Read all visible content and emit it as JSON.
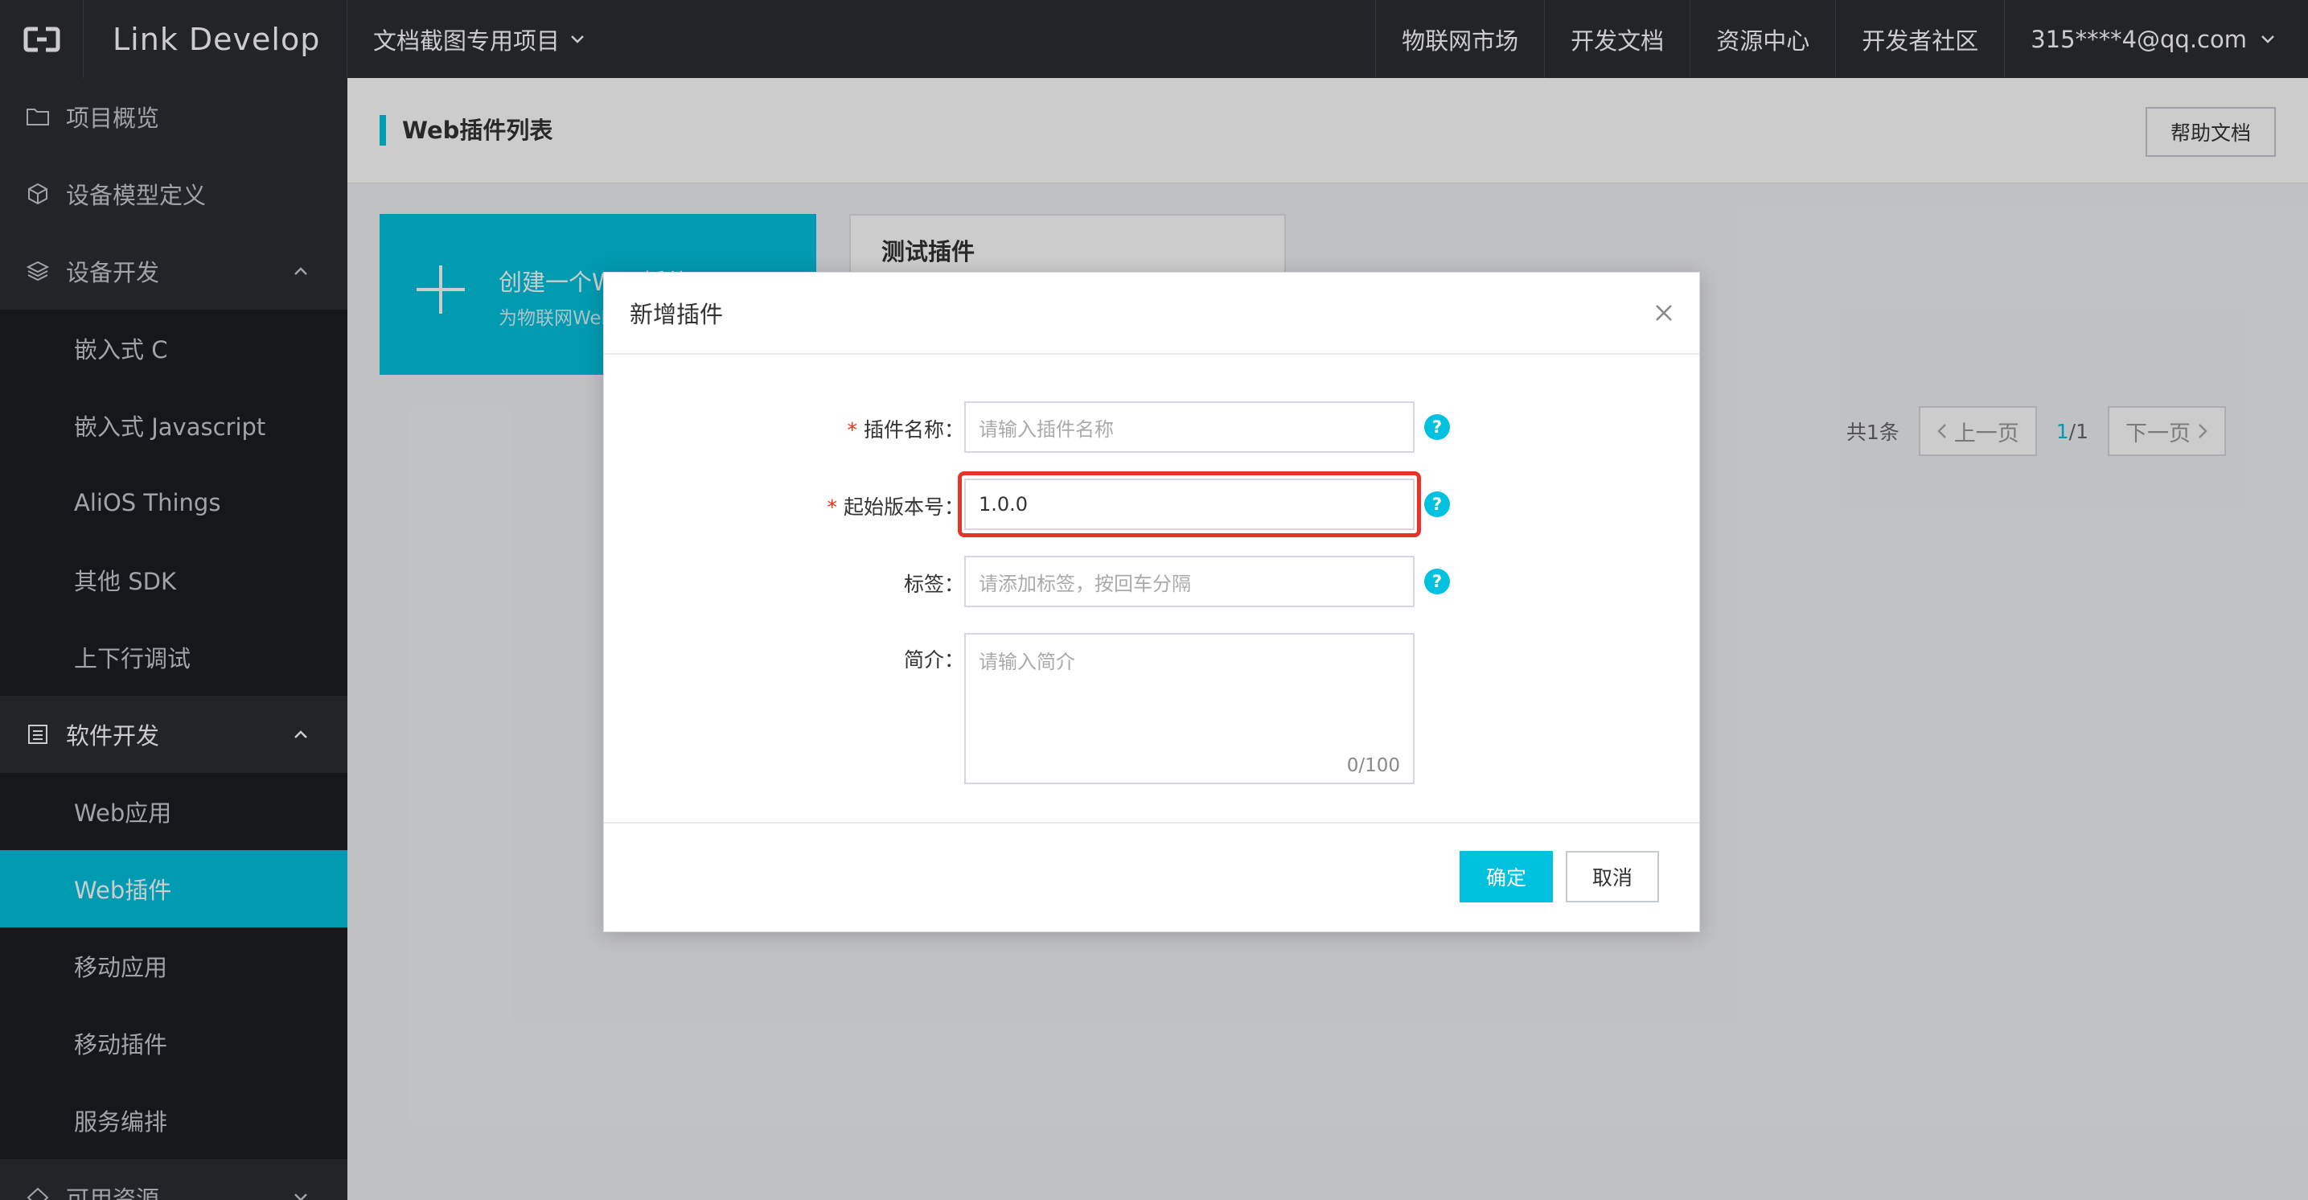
{
  "topbar": {
    "brand": "Link Develop",
    "project": "文档截图专用项目",
    "nav": [
      "物联网市场",
      "开发文档",
      "资源中心",
      "开发者社区"
    ],
    "account": "315****4@qq.com"
  },
  "sidebar": {
    "items": [
      {
        "label": "项目概览",
        "icon": "folder-icon"
      },
      {
        "label": "设备模型定义",
        "icon": "cube-icon"
      },
      {
        "label": "设备开发",
        "icon": "layers-icon"
      },
      {
        "label": "嵌入式 C"
      },
      {
        "label": "嵌入式 Javascript"
      },
      {
        "label": "AliOS Things"
      },
      {
        "label": "其他 SDK"
      },
      {
        "label": "上下行调试"
      },
      {
        "label": "软件开发",
        "icon": "document-icon"
      },
      {
        "label": "Web应用"
      },
      {
        "label": "Web插件"
      },
      {
        "label": "移动应用"
      },
      {
        "label": "移动插件"
      },
      {
        "label": "服务编排"
      },
      {
        "label": "可用资源",
        "icon": "resource-icon"
      }
    ]
  },
  "main": {
    "title": "Web插件列表",
    "help_button": "帮助文档",
    "create_card": {
      "title": "创建一个Web插件",
      "subtitle": "为物联网Web应用"
    },
    "test_card": {
      "title": "测试插件"
    },
    "pagination": {
      "total": "共1条",
      "prev": "上一页",
      "current": "1",
      "total_pages": "/1",
      "next": "下一页"
    }
  },
  "dialog": {
    "title": "新增插件",
    "fields": {
      "name": {
        "label": "插件名称：",
        "placeholder": "请输入插件名称",
        "required": true
      },
      "version": {
        "label": "起始版本号：",
        "value": "1.0.0",
        "required": true
      },
      "tags": {
        "label": "标签：",
        "placeholder": "请添加标签，按回车分隔"
      },
      "intro": {
        "label": "简介：",
        "placeholder": "请输入简介",
        "count": "0/100"
      }
    },
    "confirm": "确定",
    "cancel": "取消"
  },
  "colors": {
    "accent": "#00c1de",
    "highlight": "#e8322a",
    "topbar": "#2b2d31",
    "sidebar": "#23262b"
  }
}
